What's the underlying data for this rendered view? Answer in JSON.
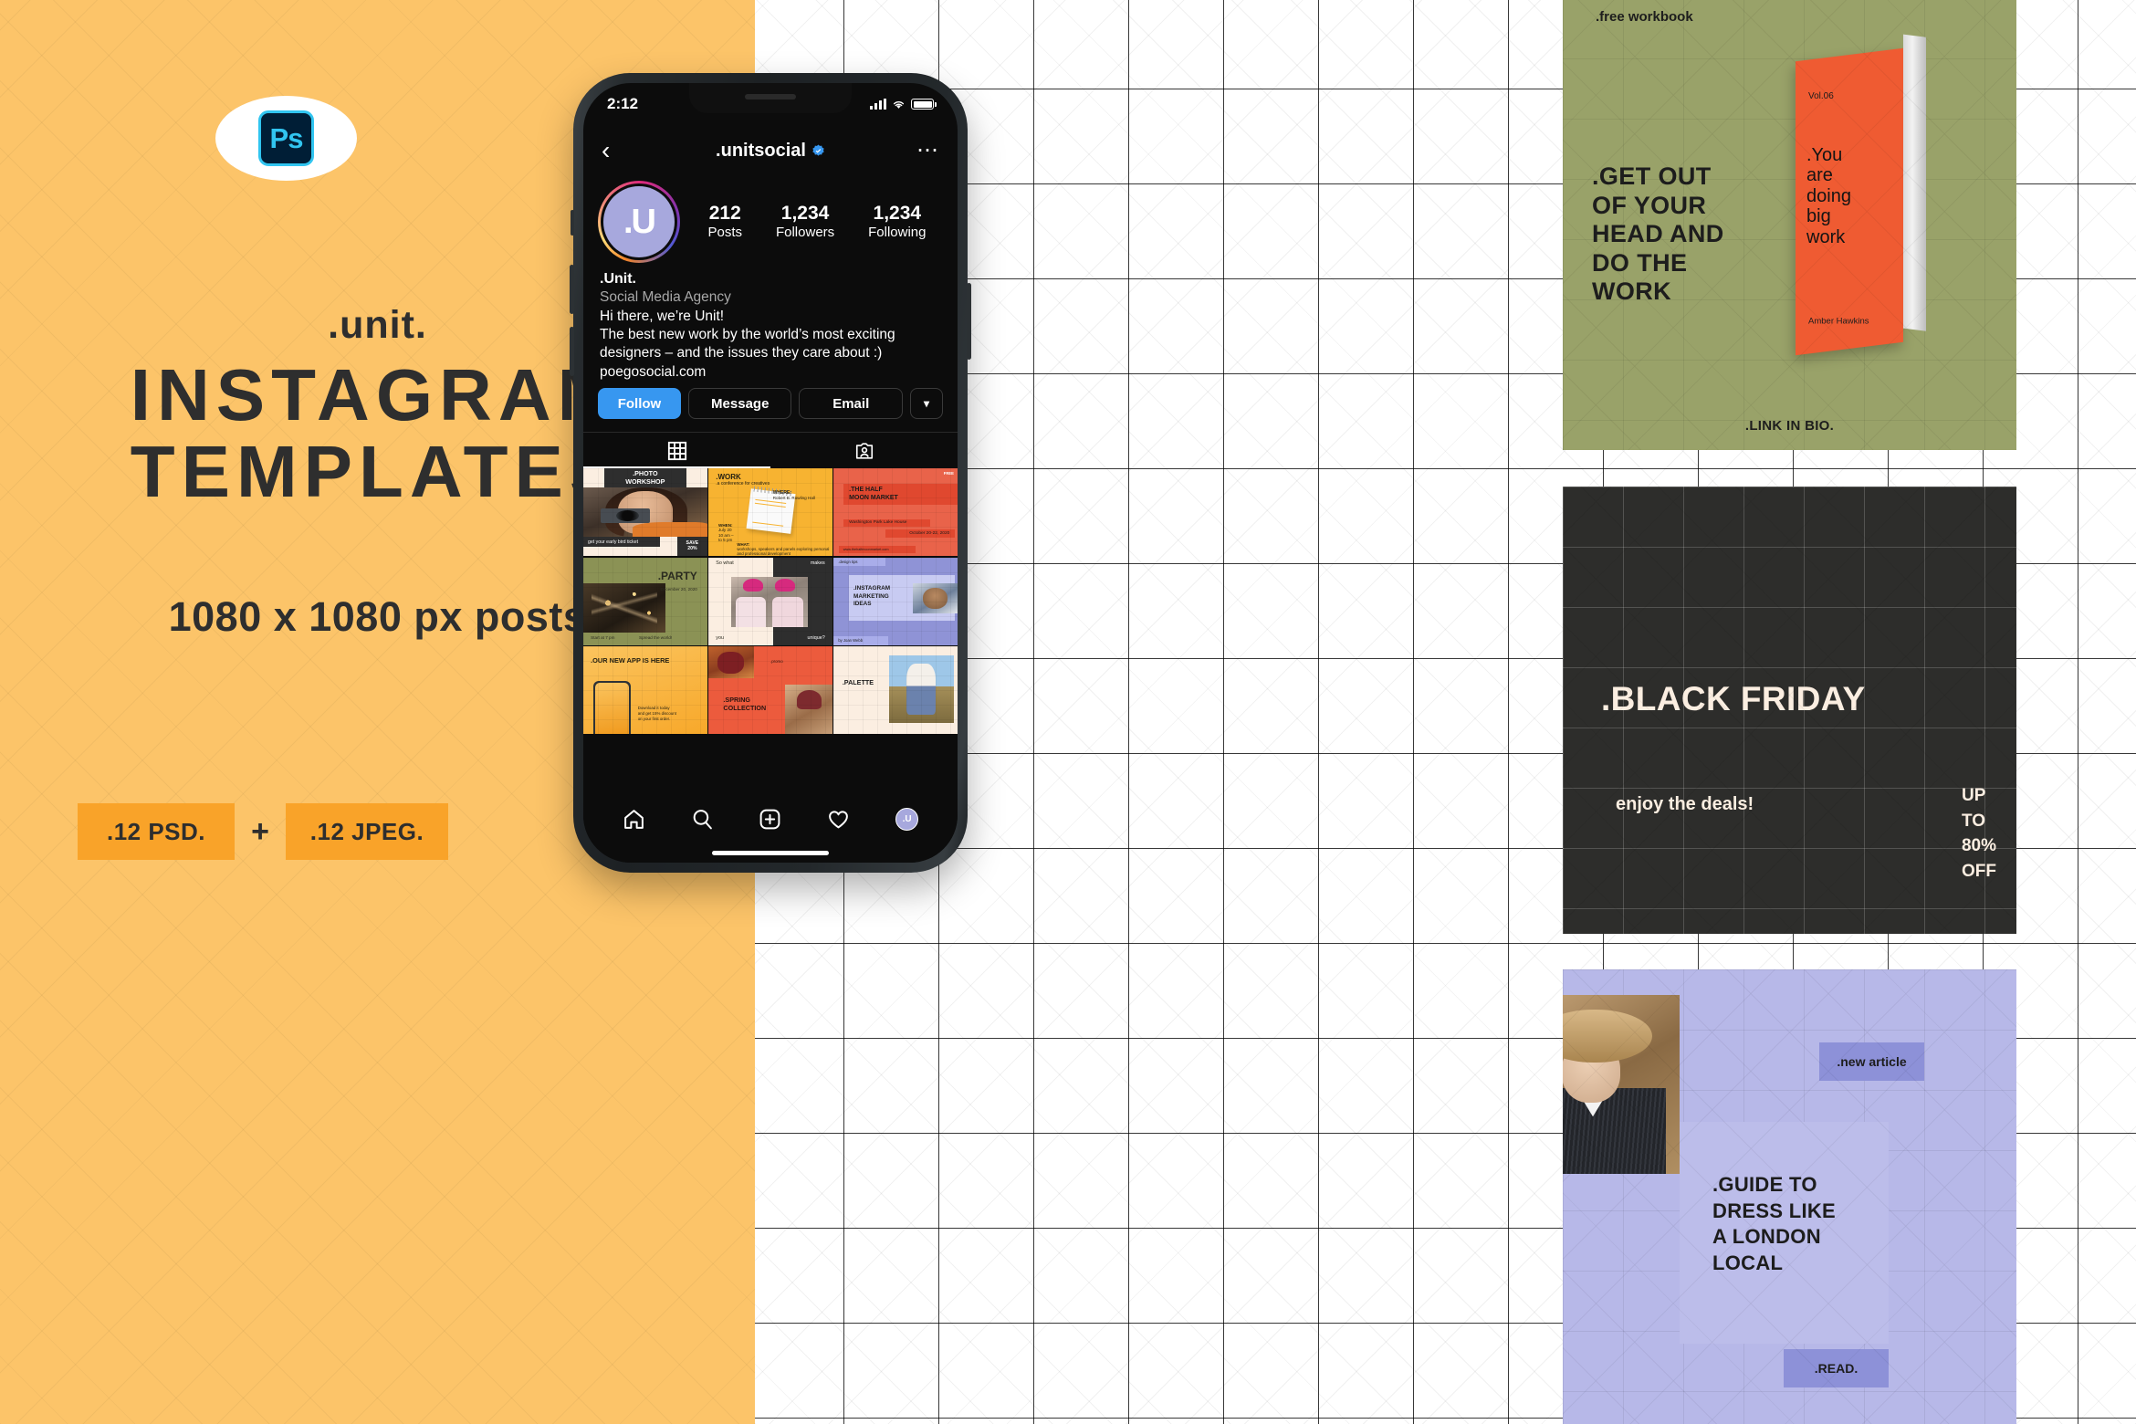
{
  "left_panel": {
    "ps_badge_label": "Ps",
    "brand": ".unit.",
    "headline_line1": "INSTAGRAM",
    "headline_line2": "TEMPLATES",
    "sizes": "1080 x 1080 px posts",
    "chip_psd": ".12 PSD.",
    "chip_plus": "+",
    "chip_jpeg": ".12 JPEG.",
    "bg_color": "#fcc469",
    "chip_color": "#f9a329",
    "text_color": "#2e2e2e"
  },
  "phone": {
    "status": {
      "time": "2:12",
      "signal_icon": "signal-bars-icon",
      "wifi_icon": "wifi-icon",
      "battery_icon": "battery-icon"
    },
    "header": {
      "back_icon": "chevron-left-icon",
      "title": ".unitsocial",
      "verified_icon": "verified-badge-icon",
      "more_icon": "more-options-icon"
    },
    "profile": {
      "avatar_label": ".U",
      "stats": [
        {
          "num": "212",
          "label": "Posts"
        },
        {
          "num": "1,234",
          "label": "Followers"
        },
        {
          "num": "1,234",
          "label": "Following"
        }
      ],
      "bio_name": ".Unit.",
      "bio_category": "Social Media Agency",
      "bio_line1": "Hi there, we’re Unit!",
      "bio_line2": "The best new work by the world’s most exciting",
      "bio_line3": "designers – and the issues they care about :)",
      "bio_link": "poegosocial.com"
    },
    "actions": {
      "follow": "Follow",
      "message": "Message",
      "email": "Email",
      "more_icon": "chevron-down-icon",
      "follow_color": "#3797f0"
    },
    "tabs": [
      {
        "name": "grid-tab",
        "icon": "grid-icon",
        "active": true
      },
      {
        "name": "tagged-tab",
        "icon": "person-tagged-icon",
        "active": false
      }
    ],
    "grid_posts": [
      {
        "id": "photo-workshop",
        "title_line1": ".PHOTO",
        "title_line2": "WORKSHOP",
        "footer": "get your early bird ticket",
        "badge_line1": "SAVE",
        "badge_line2": "20%"
      },
      {
        "id": "work-conference",
        "title": ".WORK",
        "subtitle": ".a conference for creatives",
        "where_label": "WHERE:",
        "where_value": "Robert B. Rowling Hall",
        "when_label": "WHEN:",
        "when_value": "July 20\n10 am –\nto 5 pm",
        "what_label": "WHAT:",
        "what_value": "workshops, speakers and panels exploring personal and professional development"
      },
      {
        "id": "half-moon-market",
        "free": "FREE",
        "title_line1": ".THE HALF",
        "title_line2": "MOON MARKET",
        "location": "Washington Park Lake House",
        "date": "October 20-22, 2020",
        "url": "www.thehalfmoonmarket.com"
      },
      {
        "id": "party",
        "title": ".PARTY",
        "date": "December 20, 2020",
        "footer_left": "Start at 7 pm",
        "footer_right": "Spread the world!"
      },
      {
        "id": "so-what-makes-you-unique",
        "w1": "So what",
        "w2": "makes",
        "w3": "you",
        "w4": "unique?"
      },
      {
        "id": "instagram-marketing-ideas",
        "tag": ".design tips",
        "title_line1": ".INSTAGRAM",
        "title_line2": "MARKETING",
        "title_line3": "IDEAS",
        "by": "by Joan Webb"
      },
      {
        "id": "our-new-app",
        "title": ".OUR NEW APP IS HERE",
        "detail_line1": "Download it today",
        "detail_line2": "and get 15% discount",
        "detail_line3": "on your first order."
      },
      {
        "id": "spring-collection",
        "promo": ".promo",
        "title_line1": ".SPRING",
        "title_line2": "COLLECTION"
      },
      {
        "id": "palette",
        "title": ".PALETTE"
      }
    ],
    "nav": [
      {
        "name": "home",
        "icon": "home-icon"
      },
      {
        "name": "search",
        "icon": "search-icon"
      },
      {
        "name": "create",
        "icon": "plus-box-icon"
      },
      {
        "name": "activity",
        "icon": "heart-icon"
      },
      {
        "name": "profile",
        "icon": "avatar-icon",
        "label": ".U"
      }
    ]
  },
  "cards": {
    "workbook": {
      "tag": ".free workbook",
      "heading_line1": ".GET OUT",
      "heading_line2": "OF YOUR",
      "heading_line3": "HEAD AND",
      "heading_line4": "DO THE",
      "heading_line5": "WORK",
      "link": ".LINK IN BIO.",
      "book_volume": "Vol.06",
      "book_title_line1": ".You",
      "book_title_line2": "are",
      "book_title_line3": "doing",
      "book_title_line4": "big",
      "book_title_line5": "work",
      "book_author": "Amber Hawkins",
      "bg_color": "#99a269",
      "book_color": "#ef5b32"
    },
    "black_friday": {
      "title": ".BLACK FRIDAY",
      "subtitle": "enjoy the deals!",
      "offer_line1": "UP",
      "offer_line2": "TO",
      "offer_line3": "80%",
      "offer_line4": "OFF",
      "bg_color": "#2d2d2b",
      "text_color": "#fbeee1"
    },
    "london": {
      "new_article": ".new article",
      "title_line1": ".GUIDE TO",
      "title_line2": "DRESS LIKE",
      "title_line3": "A LONDON",
      "title_line4": "LOCAL",
      "read": ".READ.",
      "bg_color": "#b7b8e8",
      "accent_color": "#8d91d8"
    }
  }
}
